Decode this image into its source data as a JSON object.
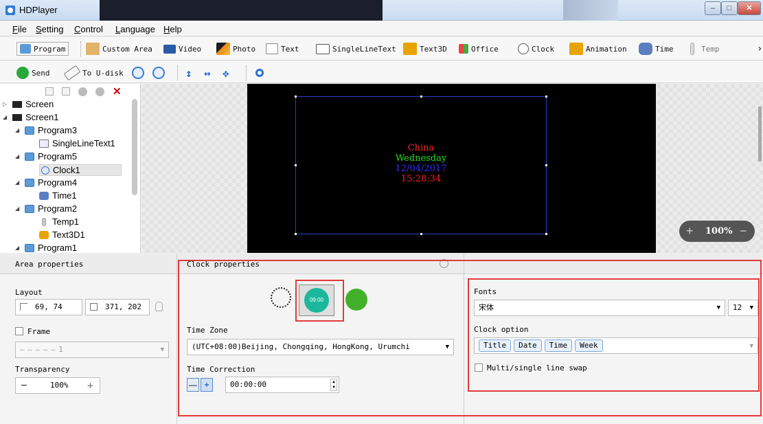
{
  "window": {
    "title": "HDPlayer",
    "min": "–",
    "max": "□",
    "close": "✕"
  },
  "menu": [
    "File",
    "Setting",
    "Control",
    "Language",
    "Help"
  ],
  "toolbar1": {
    "program": "Program",
    "custom_area": "Custom Area",
    "video": "Video",
    "photo": "Photo",
    "text": "Text",
    "single_line_text": "SingleLineText",
    "text3d": "Text3D",
    "office": "Office",
    "clock": "Clock",
    "animation": "Animation",
    "time": "Time",
    "temp": "Temp",
    "more": "›"
  },
  "toolbar2": {
    "send": "Send",
    "to_udisk": "To U-disk"
  },
  "tree": {
    "items": [
      {
        "label": "Screen",
        "type": "screen"
      },
      {
        "label": "Screen1",
        "type": "screen"
      },
      {
        "label": "Program3",
        "type": "program"
      },
      {
        "label": "SingleLineText1",
        "type": "singlelinetext"
      },
      {
        "label": "Program5",
        "type": "program"
      },
      {
        "label": "Clock1",
        "type": "clock",
        "selected": true
      },
      {
        "label": "Program4",
        "type": "program"
      },
      {
        "label": "Time1",
        "type": "time"
      },
      {
        "label": "Program2",
        "type": "program"
      },
      {
        "label": "Temp1",
        "type": "temp"
      },
      {
        "label": "Text3D1",
        "type": "text3d"
      },
      {
        "label": "Program1",
        "type": "program"
      }
    ]
  },
  "preview": {
    "lines": [
      {
        "text": "China",
        "color": "#ff2020"
      },
      {
        "text": "Wednesday",
        "color": "#20e020"
      },
      {
        "text": "12/04/2017",
        "color": "#3030ff"
      },
      {
        "text": "15:28:34",
        "color": "#ff2020"
      }
    ]
  },
  "zoom": {
    "minus": "−",
    "plus": "+",
    "value": "100%"
  },
  "area_properties": {
    "title": "Area properties",
    "layout_label": "Layout",
    "position": "69, 74",
    "size": "371, 202",
    "frame_label": "Frame",
    "frame_value": "1",
    "transparency_label": "Transparency",
    "transparency_value": "100%",
    "minus": "—",
    "plus": "+"
  },
  "clock_properties": {
    "title": "Clock properties",
    "digital_time": "09:00",
    "time_zone_label": "Time Zone",
    "time_zone_value": "(UTC+08:00)Beijing, Chongqing, HongKong, Urumchi",
    "time_correction_label": "Time Correction",
    "time_correction_value": "00:00:00"
  },
  "font_panel": {
    "fonts_label": "Fonts",
    "font_value": "宋体",
    "font_size": "12",
    "clock_option_label": "Clock option",
    "options": [
      "Title",
      "Date",
      "Time",
      "Week"
    ],
    "swap_label": "Multi/single line swap"
  },
  "colors": {
    "accent": "#e03a3a",
    "teal": "#1bb89e",
    "green": "#43b02a"
  }
}
